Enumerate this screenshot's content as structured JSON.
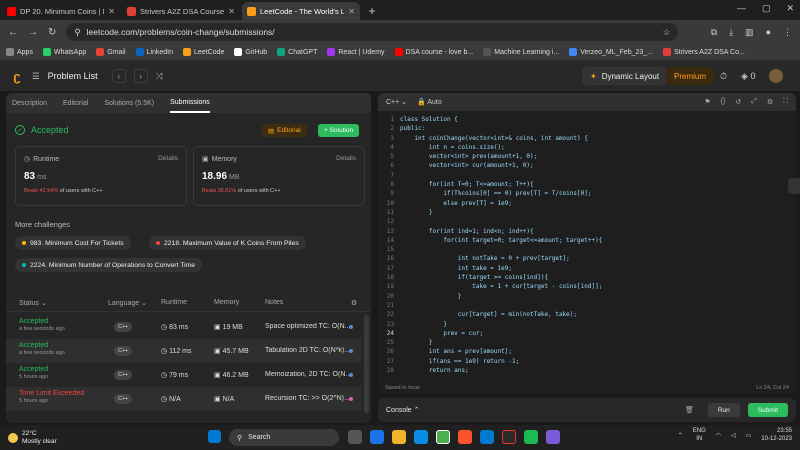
{
  "browser": {
    "tabs": [
      {
        "title": "DP 20. Minimum Coins | DP",
        "color": "#ff0000",
        "active": false
      },
      {
        "title": "Strivers A2Z DSA Course/Sheet",
        "color": "#e0403a",
        "active": false
      },
      {
        "title": "LeetCode - The World's Leading",
        "color": "#f89f1b",
        "active": true
      }
    ],
    "new_tab": "+",
    "url": "leetcode.com/problems/coin-change/submissions/",
    "bookmarks": [
      {
        "label": "Apps",
        "color": "#888"
      },
      {
        "label": "WhatsApp",
        "color": "#25d366"
      },
      {
        "label": "Gmail",
        "color": "#ea4335"
      },
      {
        "label": "LinkedIn",
        "color": "#0a66c2"
      },
      {
        "label": "LeetCode",
        "color": "#f89f1b"
      },
      {
        "label": "GitHub",
        "color": "#ffffff"
      },
      {
        "label": "ChatGPT",
        "color": "#10a37f"
      },
      {
        "label": "React | Udemy",
        "color": "#a435f0"
      },
      {
        "label": "DSA course - love b...",
        "color": "#ff0000"
      },
      {
        "label": "Machine Learning i...",
        "color": "#555"
      },
      {
        "label": "Verzeo_ML_Feb_23_...",
        "color": "#4285f4"
      },
      {
        "label": "Strivers A2Z DSA Co...",
        "color": "#e0403a"
      }
    ]
  },
  "lc_header": {
    "problem_list": "Problem List",
    "dynamic_layout": "Dynamic Layout",
    "premium": "Premium",
    "coins": "0"
  },
  "left_tabs": [
    "Description",
    "Editorial",
    "Solutions (5.5K)",
    "Submissions"
  ],
  "result": {
    "status": "Accepted",
    "editorial_btn": "Editorial",
    "solution_btn": "+ Solution",
    "runtime": {
      "label": "Runtime",
      "details": "Details",
      "value": "83",
      "unit": "ms",
      "beats_pct": "Beats 42.54%",
      "beats_rest": "of users with C++"
    },
    "memory": {
      "label": "Memory",
      "details": "Details",
      "value": "18.96",
      "unit": "MB",
      "beats_pct": "Beats 36.81%",
      "beats_rest": "of users with C++"
    }
  },
  "challenges": {
    "title": "More challenges",
    "items": [
      {
        "label": "983. Minimum Cost For Tickets",
        "color": "#ffb800"
      },
      {
        "label": "2218. Maximum Value of K Coins From Piles",
        "color": "#ef4743"
      },
      {
        "label": "2224. Minimum Number of Operations to Convert Time",
        "color": "#00b8a3"
      }
    ]
  },
  "table": {
    "headers": [
      "Status",
      "Language",
      "Runtime",
      "Memory",
      "Notes"
    ],
    "rows": [
      {
        "status": "Accepted",
        "time": "a few seconds ago",
        "lang": "C++",
        "runtime": "83 ms",
        "memory": "19 MB",
        "note": "Space optimized TC: O(N...",
        "color": "#2cbb5d",
        "dot": "#4a90e2"
      },
      {
        "status": "Accepted",
        "time": "a few seconds ago",
        "lang": "C++",
        "runtime": "112 ms",
        "memory": "45.7 MB",
        "note": "Tabulation 2D TC: O(N*k)...",
        "color": "#2cbb5d",
        "dot": "#4a90e2"
      },
      {
        "status": "Accepted",
        "time": "5 hours ago",
        "lang": "C++",
        "runtime": "79 ms",
        "memory": "46.2 MB",
        "note": "Memoization, 2D TC: O(N...",
        "color": "#2cbb5d",
        "dot": "#4a90e2"
      },
      {
        "status": "Time Limit Exceeded",
        "time": "5 hours ago",
        "lang": "C++",
        "runtime": "N/A",
        "memory": "N/A",
        "note": "Recursion TC: >> O(2^N)...",
        "color": "#ef4743",
        "dot": "#e05eb0"
      }
    ]
  },
  "editor": {
    "language": "C++",
    "mode": "Auto",
    "saved": "Saved to local",
    "cursor": "Ln 24, Col 24",
    "lines": [
      "class Solution {",
      "public:",
      "    int coinChange(vector<int>& coins, int amount) {",
      "        int n = coins.size();",
      "        vector<int> prev(amount+1, 0);",
      "        vector<int> cur(amount+1, 0);",
      "",
      "        for(int T=0; T<=amount; T++){",
      "            if(T%coins[0] == 0) prev[T] = T/coins[0];",
      "            else prev[T] = 1e9;",
      "        }",
      "",
      "        for(int ind=1; ind<n; ind++){",
      "            for(int target=0; target<=amount; target++){",
      "",
      "                int notTake = 0 + prev[target];",
      "                int take = 1e9;",
      "                if(target >= coins[ind]){",
      "                    take = 1 + cur[target - coins[ind]];",
      "                }",
      "",
      "                cur[target] = min(notTake, take);",
      "            }",
      "            prev = cur;",
      "        }",
      "        int ans = prev[amount];",
      "        if(ans == 1e9) return -1;",
      "        return ans;"
    ]
  },
  "console": {
    "label": "Console",
    "run": "Run",
    "submit": "Submit"
  },
  "taskbar": {
    "temp": "22°C",
    "weather": "Mostly clear",
    "search": "Search",
    "lang": "ENG",
    "region": "IN",
    "time": "23:55",
    "date": "10-12-2023"
  }
}
